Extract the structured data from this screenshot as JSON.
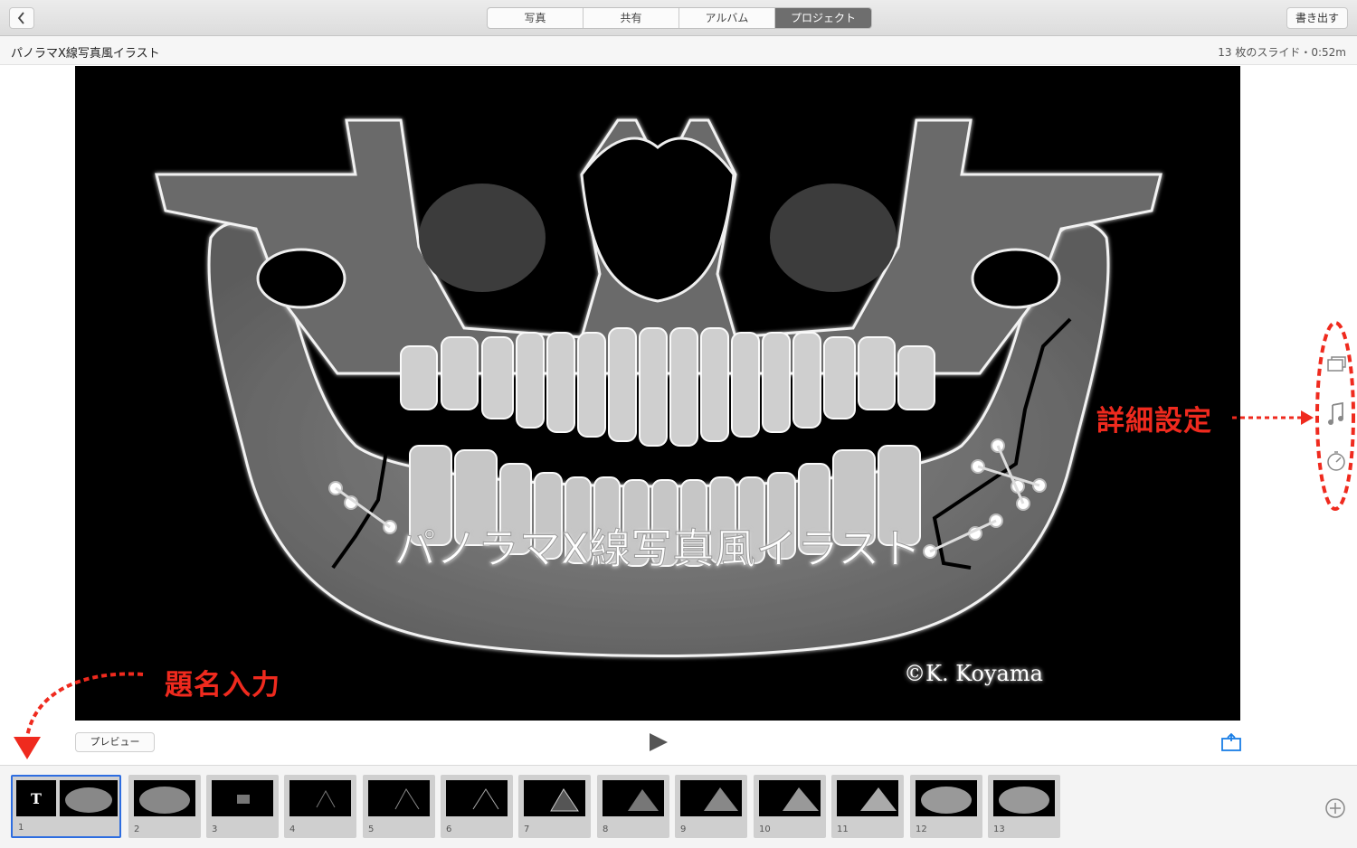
{
  "toolbar": {
    "tabs": [
      {
        "label": "写真",
        "active": false
      },
      {
        "label": "共有",
        "active": false
      },
      {
        "label": "アルバム",
        "active": false
      },
      {
        "label": "プロジェクト",
        "active": true
      }
    ],
    "export_label": "書き出す"
  },
  "project": {
    "title": "パノラマX線写真風イラスト",
    "slide_info": "13 枚のスライド・0:52m"
  },
  "slide": {
    "caption": "パノラマX線写真風イラスト",
    "copyright": "©K. Koyama"
  },
  "controls": {
    "preview_label": "プレビュー"
  },
  "thumbnails": [
    {
      "number": "1",
      "title_marker": "T"
    },
    {
      "number": "2"
    },
    {
      "number": "3"
    },
    {
      "number": "4"
    },
    {
      "number": "5"
    },
    {
      "number": "6"
    },
    {
      "number": "7"
    },
    {
      "number": "8"
    },
    {
      "number": "9"
    },
    {
      "number": "10"
    },
    {
      "number": "11"
    },
    {
      "number": "12"
    },
    {
      "number": "13"
    }
  ],
  "annotations": {
    "settings": "詳細設定",
    "title_input": "題名入力"
  },
  "colors": {
    "accent": "#1a7ee6",
    "annotation": "#ef2a1e",
    "active_tab": "#6e6e6e"
  }
}
